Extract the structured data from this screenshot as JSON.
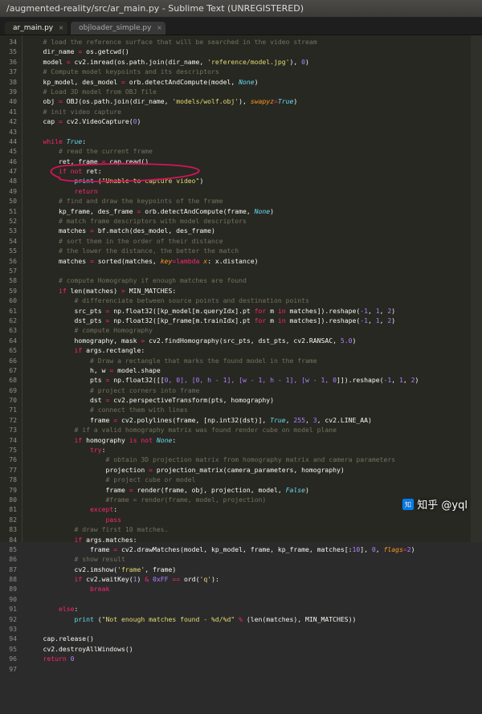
{
  "window": {
    "title": "/augmented-reality/src/ar_main.py - Sublime Text (UNREGISTERED)"
  },
  "tabs": [
    {
      "label": "ar_main.py",
      "active": true
    },
    {
      "label": "objloader_simple.py",
      "active": false
    }
  ],
  "gutter": {
    "start": 34,
    "end": 97
  },
  "code": {
    "l34": "# load the reference surface that will be searched in the video stream",
    "l35a": "dir_name ",
    "l35b": " os.getcwd()",
    "l36a": "model ",
    "l36b": " cv2.imread(os.path.join(dir_name, ",
    "l36s": "'reference/model.jpg'",
    "l36c": "), ",
    "l36n": "0",
    "l36d": ")",
    "l37": "# Compute model keypoints and its descriptors",
    "l38a": "kp_model, des_model ",
    "l38b": " orb.detectAndCompute(model, ",
    "l38n": "None",
    "l38c": ")",
    "l39": "# Load 3D model from OBJ file",
    "l40a": "obj ",
    "l40b": " OBJ(os.path.join(dir_name, ",
    "l40s": "'models/wolf.obj'",
    "l40c": "), ",
    "l40kw": "swapyz",
    "l40eq": "=",
    "l40v": "True",
    "l40d": ")",
    "l41": "# init video capture",
    "l42a": "cap ",
    "l42b": " cv2.VideoCapture(",
    "l42n": "0",
    "l42c": ")",
    "l44a": "while",
    "l44b": " ",
    "l44c": "True",
    "l44d": ":",
    "l45": "# read the current frame",
    "l46a": "ret, frame ",
    "l46b": " cap.read()",
    "l47a": "if",
    "l47b": " ",
    "l47c": "not",
    "l47d": " ret:",
    "l48a": "print",
    "l48b": " (",
    "l48s": "\"Unable to capture video\"",
    "l48c": ")",
    "l49": "return",
    "l50": "# find and draw the keypoints of the frame",
    "l51a": "kp_frame, des_frame ",
    "l51b": " orb.detectAndCompute(frame, ",
    "l51n": "None",
    "l51c": ")",
    "l52": "# match frame descriptors with model descriptors",
    "l53a": "matches ",
    "l53b": " bf.match(des_model, des_frame)",
    "l54": "# sort them in the order of their distance",
    "l55": "# the lower the distance, the better the match",
    "l56a": "matches ",
    "l56b": " sorted(matches, ",
    "l56kw": "key",
    "l56eq": "=",
    "l56lm": "lambda",
    "l56x": " x",
    "l56c": ": x.distance)",
    "l58": "# compute Homography if enough matches are found",
    "l59a": "if",
    "l59b": " len(matches) ",
    "l59op": ">",
    "l59c": " MIN_MATCHES:",
    "l60": "# differenciate between source points and destination points",
    "l61a": "src_pts ",
    "l61b": " np.float32([kp_model[m.queryIdx].pt ",
    "l61f": "for",
    "l61c": " m ",
    "l61in": "in",
    "l61d": " matches]).reshape(",
    "l61n1": "-1",
    "l61cm": ", ",
    "l61n2": "1",
    "l61cm2": ", ",
    "l61n3": "2",
    "l61e": ")",
    "l62a": "dst_pts ",
    "l62b": " np.float32([kp_frame[m.trainIdx].pt ",
    "l62f": "for",
    "l62c": " m ",
    "l62in": "in",
    "l62d": " matches]).reshape(",
    "l62n1": "-1",
    "l62cm": ", ",
    "l62n2": "1",
    "l62cm2": ", ",
    "l62n3": "2",
    "l62e": ")",
    "l63": "# compute Homography",
    "l64a": "homography, mask ",
    "l64b": " cv2.findHomography(src_pts, dst_pts, cv2.RANSAC, ",
    "l64n": "5.0",
    "l64c": ")",
    "l65a": "if",
    "l65b": " args.rectangle:",
    "l66": "# Draw a rectangle that marks the found model in the frame",
    "l67a": "h, w ",
    "l67b": " model.shape",
    "l68a": "pts ",
    "l68b": " np.float32([[",
    "l68v": "0, 0], [0, h - 1], [w - 1, h - 1], [w - 1, 0",
    "l68c": "]]).reshape(",
    "l68n1": "-1",
    "l68cm": ", ",
    "l68n2": "1",
    "l68cm2": ", ",
    "l68n3": "2",
    "l68e": ")",
    "l69": "# project corners into frame",
    "l70a": "dst ",
    "l70b": " cv2.perspectiveTransform(pts, homography)",
    "l71": "# connect them with lines",
    "l72a": "frame ",
    "l72b": " cv2.polylines(frame, [np.int32(dst)], ",
    "l72t": "True",
    "l72c": ", ",
    "l72n1": "255",
    "l72cm": ", ",
    "l72n2": "3",
    "l72cm2": ", cv2.LINE_AA)",
    "l73": "# if a valid homography matrix was found render cube on model plane",
    "l74a": "if",
    "l74b": " homography ",
    "l74is": "is",
    "l74c": " ",
    "l74not": "not",
    "l74d": " ",
    "l74n": "None",
    "l74e": ":",
    "l75a": "try",
    "l75b": ":",
    "l76": "# obtain 3D projection matrix from homography matrix and camera parameters",
    "l77a": "projection ",
    "l77b": " projection_matrix(camera_parameters, homography)",
    "l78": "# project cube or model",
    "l79a": "frame ",
    "l79b": " render(frame, obj, projection, model, ",
    "l79f": "False",
    "l79c": ")",
    "l80": "#frame = render(frame, model, projection)",
    "l81a": "except",
    "l81b": ":",
    "l82": "pass",
    "l83": "# draw first 10 matches.",
    "l84a": "if",
    "l84b": " args.matches:",
    "l85a": "frame ",
    "l85b": " cv2.drawMatches(model, kp_model, frame, kp_frame, matches[:",
    "l85n": "10",
    "l85c": "], ",
    "l85n2": "0",
    "l85cm": ", ",
    "l85kw": "flags",
    "l85eq": "=",
    "l85n3": "2",
    "l85d": ")",
    "l86": "# show result",
    "l87a": "cv2.imshow(",
    "l87s": "'frame'",
    "l87b": ", frame)",
    "l88a": "if",
    "l88b": " cv2.waitKey(",
    "l88n": "1",
    "l88c": ") ",
    "l88amp": "&",
    "l88d": " ",
    "l88hex": "0xFF",
    "l88e": " ",
    "l88eq": "==",
    "l88f": " ord(",
    "l88s": "'q'",
    "l88g": "):",
    "l89": "break",
    "l91a": "else",
    "l91b": ":",
    "l92a": "print",
    "l92b": " (",
    "l92s": "\"Not enough matches found - %d/%d\"",
    "l92c": " ",
    "l92op": "%",
    "l92d": " (len(matches), MIN_MATCHES))",
    "l94": "cap.release()",
    "l95": "cv2.destroyAllWindows()",
    "l96a": "return",
    "l96b": " ",
    "l96n": "0"
  },
  "watermark": "知乎 @yql"
}
